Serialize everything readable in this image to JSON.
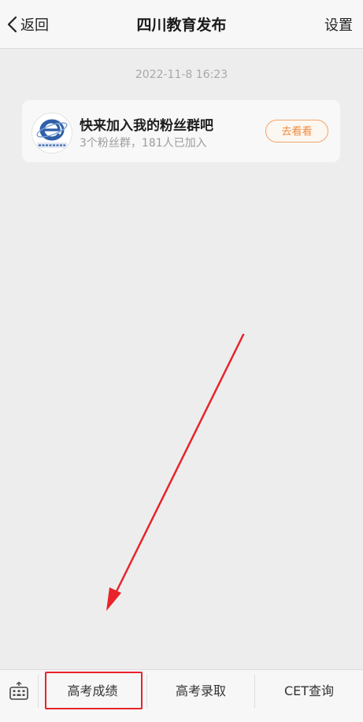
{
  "navbar": {
    "back_label": "返回",
    "title": "四川教育发布",
    "settings_label": "设置"
  },
  "chat": {
    "timestamp": "2022-11-8 16:23",
    "card": {
      "avatar_logo_text": "四川省教育厅",
      "title": "快来加入我的粉丝群吧",
      "subtitle": "3个粉丝群，181人已加入",
      "button_label": "去看看"
    }
  },
  "bottom_menu": {
    "items": [
      {
        "label": "高考成绩"
      },
      {
        "label": "高考录取"
      },
      {
        "label": "CET查询"
      }
    ]
  },
  "colors": {
    "accent_orange": "#f08a3e",
    "annotation_red": "#e8232a",
    "logo_blue": "#2f5fa8"
  }
}
